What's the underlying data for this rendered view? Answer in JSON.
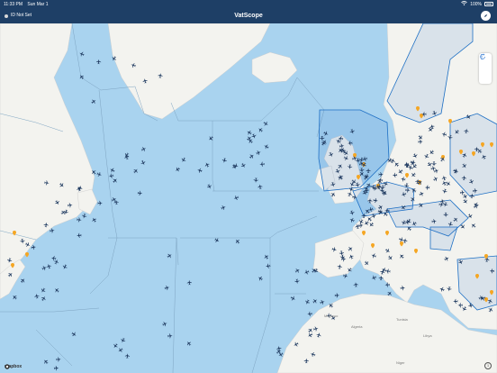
{
  "status_bar": {
    "time": "11:33 PM",
    "date": "Sun Mar 1",
    "battery": "100%"
  },
  "nav": {
    "title": "VatScope",
    "id_status": "ID Not Set"
  },
  "map": {
    "attribution": "mapbox",
    "labels": [
      "Algeria",
      "Libya",
      "Morocco",
      "Tunisia",
      "Niger"
    ],
    "colors": {
      "ocean": "#a9d3ef",
      "land": "#f2f2ee",
      "aircraft": "#1f3a60",
      "airport": "#f5a623",
      "sector_outline": "#1d6fc4"
    }
  },
  "controls": {
    "items": [
      "locate-icon",
      "more-icon"
    ]
  }
}
